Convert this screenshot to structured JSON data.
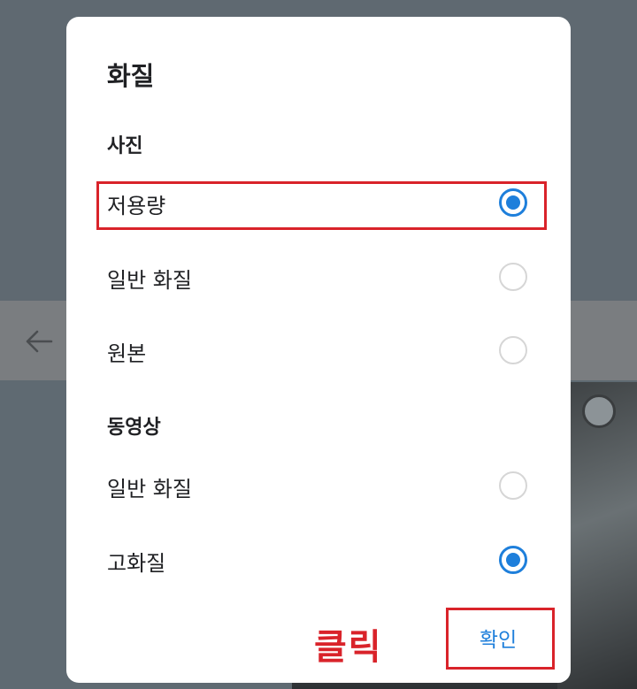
{
  "dialog": {
    "title": "화질",
    "sections": [
      {
        "header": "사진",
        "options": [
          {
            "label": "저용량",
            "checked": true
          },
          {
            "label": "일반 화질",
            "checked": false
          },
          {
            "label": "원본",
            "checked": false
          }
        ]
      },
      {
        "header": "동영상",
        "options": [
          {
            "label": "일반 화질",
            "checked": false
          },
          {
            "label": "고화질",
            "checked": true
          }
        ]
      }
    ],
    "confirm_label": "확인"
  },
  "annotation": {
    "click_label": "클릭",
    "highlight_color": "#d9232a"
  },
  "colors": {
    "accent": "#1e7fdb",
    "radio_unchecked": "#d6d6d6",
    "text": "#202124"
  },
  "background": {
    "back_icon": "arrow-left-icon"
  }
}
